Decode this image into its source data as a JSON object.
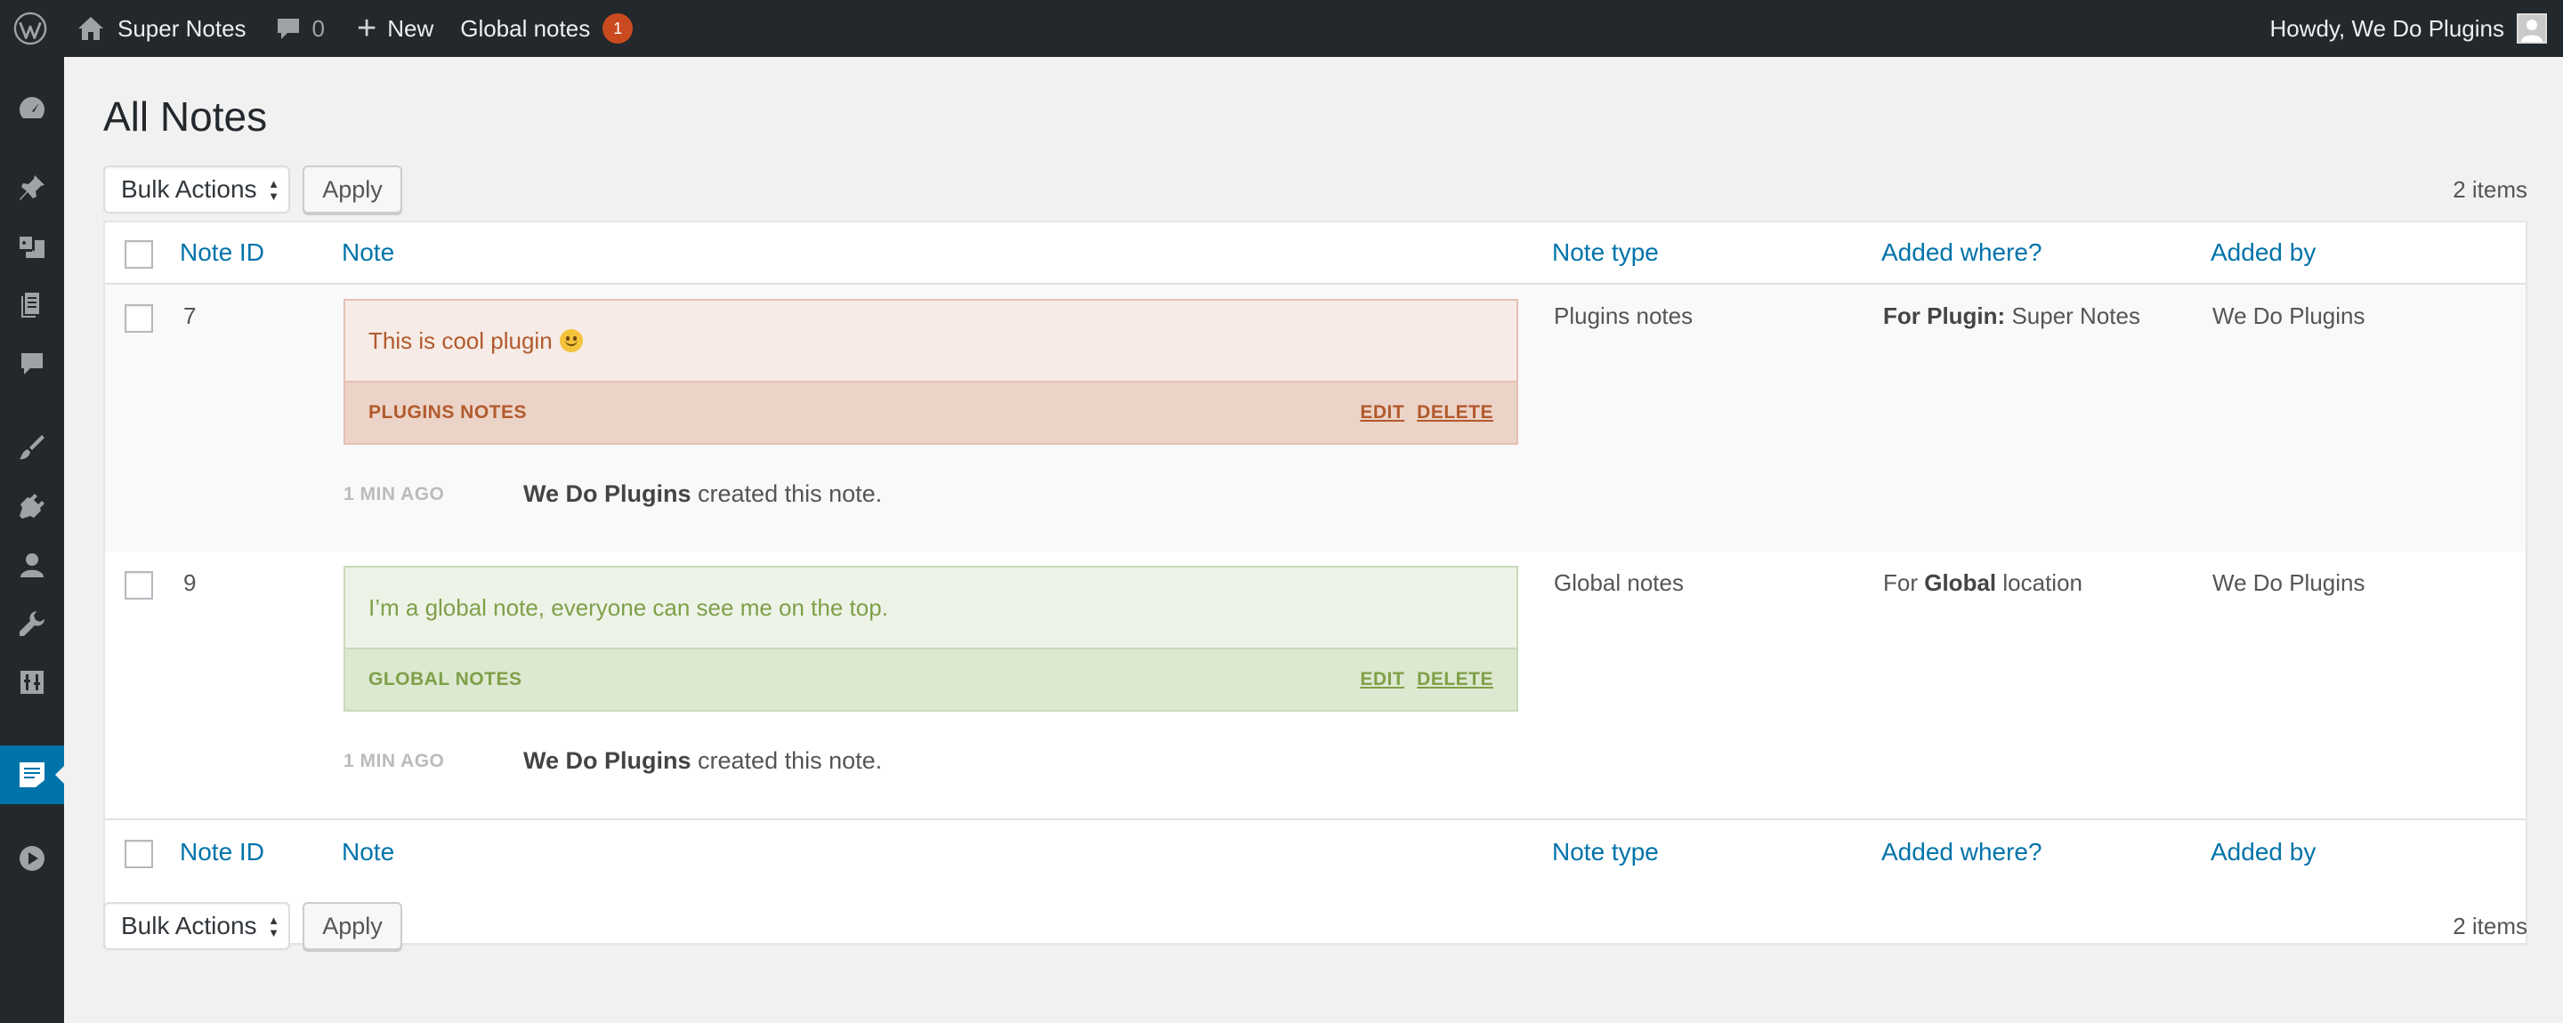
{
  "adminbar": {
    "site_name": "Super Notes",
    "comments_count": "0",
    "new_label": "New",
    "global_notes_label": "Global notes",
    "global_notes_badge": "1",
    "howdy": "Howdy, We Do Plugins"
  },
  "sidebar": {
    "icons": [
      "dashboard-icon",
      "pin-icon",
      "media-icon",
      "pages-icon",
      "comments-icon",
      "appearance-icon",
      "plugins-icon",
      "users-icon",
      "tools-icon",
      "settings-icon",
      "notes-icon",
      "play-icon"
    ],
    "current": "notes-icon"
  },
  "page": {
    "title": "All Notes"
  },
  "tablenav_top": {
    "bulk_actions": "Bulk Actions",
    "apply": "Apply",
    "items": "2 items"
  },
  "tablenav_bottom": {
    "bulk_actions": "Bulk Actions",
    "apply": "Apply",
    "items": "2 items"
  },
  "columns": {
    "id": "Note ID",
    "note": "Note",
    "type": "Note type",
    "where": "Added where?",
    "by": "Added by"
  },
  "rows": [
    {
      "id": "7",
      "note_text": "This is cool plugin",
      "note_label": "PLUGINS NOTES",
      "edit": "EDIT",
      "delete": "DELETE",
      "time": "1 MIN AGO",
      "meta_author": "We Do Plugins",
      "meta_suffix": "created this note.",
      "type": "Plugins notes",
      "where_prefix": "For Plugin:",
      "where_value": "Super Notes",
      "by": "We Do Plugins"
    },
    {
      "id": "9",
      "note_text": "I’m a global note, everyone can see me on the top.",
      "note_label": "GLOBAL NOTES",
      "edit": "EDIT",
      "delete": "DELETE",
      "time": "1 MIN AGO",
      "meta_author": "We Do Plugins",
      "meta_suffix": "created this note.",
      "type": "Global notes",
      "where_prefix": "For",
      "where_value": "Global",
      "where_suffix": "location",
      "by": "We Do Plugins"
    }
  ],
  "colors": {
    "adminbar_bg": "#23282d",
    "accent": "#0073aa",
    "badge": "#ca4a1f",
    "plugin_note": "#b25a2c",
    "global_note": "#7ea048"
  }
}
